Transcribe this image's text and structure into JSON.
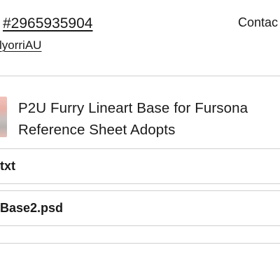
{
  "order": {
    "number_link": "#2965935904",
    "contact_label": "Contac",
    "seller_link": "lyorriAU"
  },
  "item": {
    "title": "P2U Furry Lineart Base for Fursona Reference Sheet Adopts"
  },
  "files": [
    {
      "name": "txt"
    },
    {
      "name": "Base2.psd"
    }
  ]
}
